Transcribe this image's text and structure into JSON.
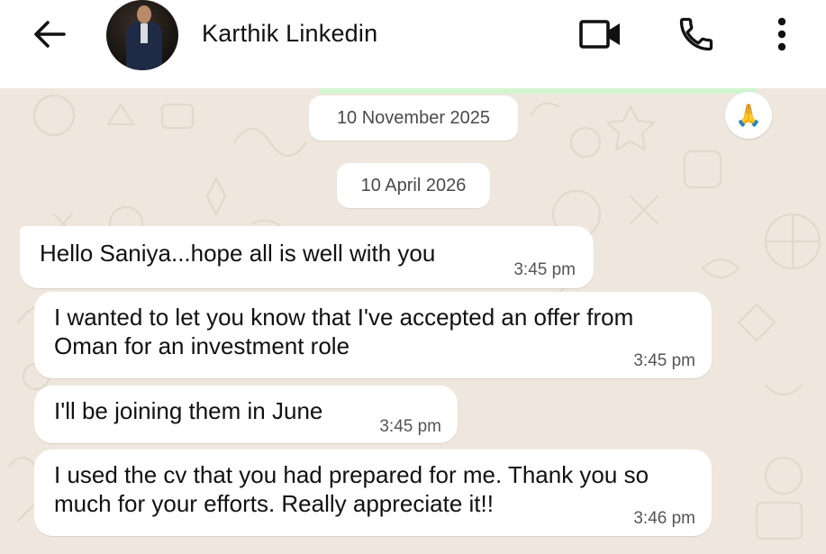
{
  "header": {
    "contact_name": "Karthik Linkedin",
    "icons": [
      "back-arrow-icon",
      "video-call-icon",
      "phone-icon",
      "more-options-icon"
    ]
  },
  "chat": {
    "date_chips": [
      "10 November 2025",
      "10 April 2026"
    ],
    "reaction_emoji": "🙏",
    "messages": [
      {
        "text": "Hello Saniya...hope all is well with you",
        "time": "3:45 pm"
      },
      {
        "text": "I wanted to let you know that I've accepted an offer from\nOman for an investment role",
        "time": "3:45 pm"
      },
      {
        "text": "I'll be joining them in June",
        "time": "3:45 pm"
      },
      {
        "text": "I used the cv that you had prepared for me. Thank you so\nmuch for your efforts. Really appreciate it!!",
        "time": "3:46 pm"
      }
    ]
  },
  "colors": {
    "header_bg": "#ffffff",
    "chat_bg": "#efe7dd",
    "bubble_bg": "#ffffff",
    "text": "#111111",
    "timestamp": "#555555"
  }
}
